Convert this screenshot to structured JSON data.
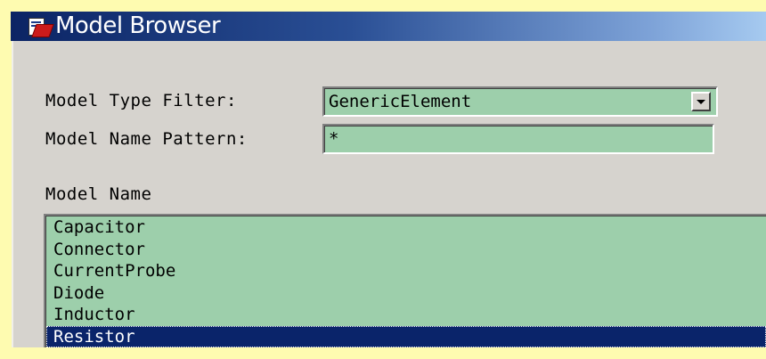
{
  "window": {
    "title": "Model Browser",
    "app_icon": "model-browser-app-icon"
  },
  "filters": {
    "type_label": "Model Type Filter:",
    "type_value": "GenericElement",
    "name_pattern_label": "Model Name Pattern:",
    "name_pattern_value": "*"
  },
  "list": {
    "header": "Model Name",
    "items": [
      {
        "label": "Capacitor",
        "selected": false
      },
      {
        "label": "Connector",
        "selected": false
      },
      {
        "label": "CurrentProbe",
        "selected": false
      },
      {
        "label": "Diode",
        "selected": false
      },
      {
        "label": "Inductor",
        "selected": false
      },
      {
        "label": "Resistor",
        "selected": true
      }
    ]
  },
  "colors": {
    "field_bg": "#9dcfab",
    "selection_bg": "#0a246a",
    "dialog_bg": "#d6d3ce",
    "page_bg": "#fefbb0"
  }
}
